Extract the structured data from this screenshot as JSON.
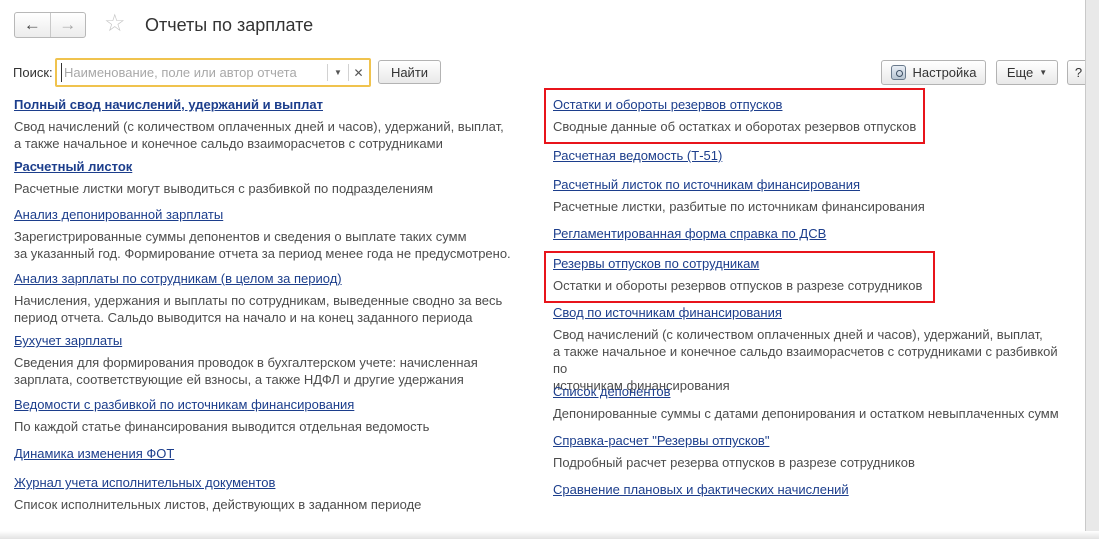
{
  "header": {
    "back_glyph": "←",
    "forward_glyph": "→",
    "title": "Отчеты по зарплате"
  },
  "search": {
    "label": "Поиск:",
    "placeholder": "Наименование, поле или автор отчета",
    "value": "",
    "find_label": "Найти"
  },
  "toolbar": {
    "settings_label": "Настройка",
    "more_label": "Еще",
    "help_label": "?"
  },
  "left_reports": [
    {
      "title": "Полный свод начислений, удержаний и выплат",
      "description": "Свод начислений (с количеством оплаченных дней и часов), удержаний, выплат,\nа также начальное и конечное сальдо взаиморасчетов с сотрудниками"
    },
    {
      "title": "Расчетный листок",
      "description": "Расчетные листки могут выводиться с разбивкой по подразделениям"
    },
    {
      "title": "Анализ депонированной зарплаты",
      "description": "Зарегистрированные суммы депонентов и сведения о выплате таких сумм\nза указанный год. Формирование отчета за период менее года не предусмотрено."
    },
    {
      "title": "Анализ зарплаты по сотрудникам (в целом за период)",
      "description": "Начисления, удержания и выплаты по сотрудникам, выведенные сводно за весь\nпериод отчета. Сальдо выводится на начало и на конец заданного периода"
    },
    {
      "title": "Бухучет зарплаты",
      "description": "Сведения для формирования проводок в бухгалтерском учете: начисленная\nзарплата, соответствующие ей взносы, а также НДФЛ и другие удержания"
    },
    {
      "title": "Ведомости с разбивкой по источникам финансирования",
      "description": "По каждой статье финансирования выводится отдельная ведомость"
    },
    {
      "title": "Динамика изменения ФОТ",
      "description": ""
    },
    {
      "title": "Журнал учета исполнительных документов",
      "description": "Список исполнительных листов, действующих в заданном периоде"
    }
  ],
  "right_reports": [
    {
      "title": "Остатки и обороты резервов отпусков",
      "description": "Сводные данные об остатках и оборотах резервов отпусков"
    },
    {
      "title": "Расчетная ведомость (Т-51)",
      "description": ""
    },
    {
      "title": "Расчетный листок по источникам финансирования",
      "description": "Расчетные листки, разбитые по источникам финансирования"
    },
    {
      "title": "Регламентированная форма справка по ДСВ",
      "description": ""
    },
    {
      "title": "Резервы отпусков по сотрудникам",
      "description": "Остатки и обороты резервов отпусков в разрезе сотрудников"
    },
    {
      "title": "Свод по источникам финансирования",
      "description": "Свод начислений (с количеством оплаченных дней и часов), удержаний, выплат,\nа также начальное и конечное сальдо взаиморасчетов с сотрудниками с разбивкой по\nисточникам финансирования"
    },
    {
      "title": "Список депонентов",
      "description": "Депонированные суммы с датами депонирования и остатком невыплаченных сумм"
    },
    {
      "title": "Справка-расчет \"Резервы отпусков\"",
      "description": "Подробный расчет резерва отпусков в разрезе сотрудников"
    },
    {
      "title": "Сравнение плановых и фактических начислений",
      "description": ""
    }
  ],
  "colors": {
    "link": "#1c3e8c",
    "highlight": "#e8141b",
    "search_focus": "#f0c34e"
  }
}
